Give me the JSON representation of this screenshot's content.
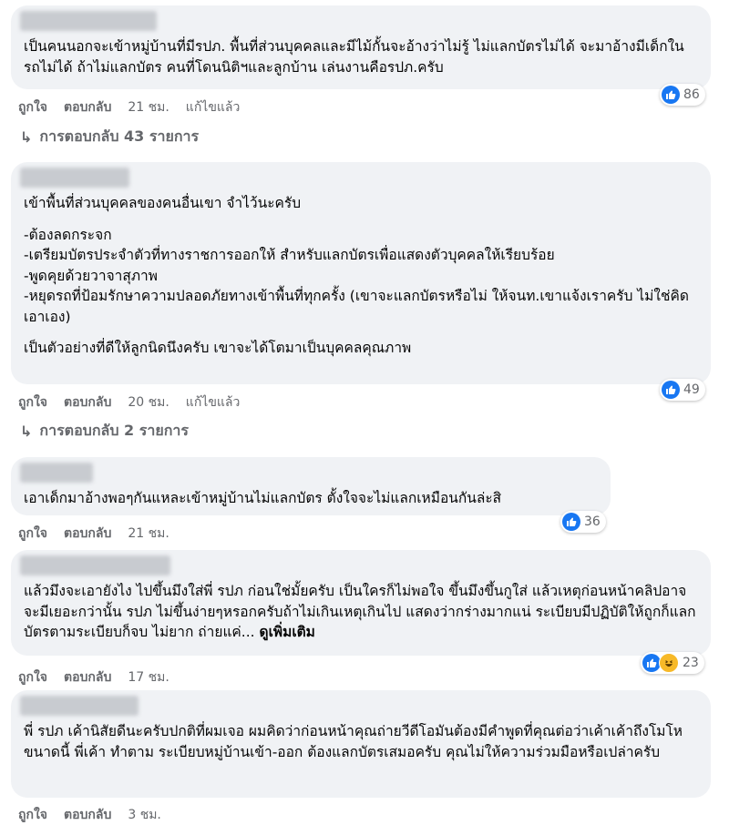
{
  "labels": {
    "like": "ถูกใจ",
    "reply": "ตอบกลับ",
    "see_more": "ดูเพิ่มเติม"
  },
  "comments": [
    {
      "paragraphs": [
        "เป็นคนนอกจะเข้าหมู่บ้านที่มีรปภ. พื้นที่ส่วนบุคคลและมีไม้กั้นจะอ้างว่าไม่รู้ ไม่แลกบัตรไม่ได้ จะมาอ้างมีเด็กในรถไม่ได้ ถ้าไม่แลกบัตร คนที่โดนนิติฯและลูกบ้าน เล่นงานคือรปภ.ครับ"
      ],
      "time": "21 ชม.",
      "edited": "แก้ไขแล้ว",
      "reactions": "86",
      "replies": "การตอบกลับ 43 รายการ"
    },
    {
      "paragraphs": [
        "เข้าพื้นที่ส่วนบุคคลของคนอื่นเขา จำไว้นะครับ",
        "-ต้องลดกระจก",
        "-เตรียมบัตรประจำตัวที่ทางราชการออกให้ สำหรับแลกบัตรเพื่อแสดงตัวบุคคลให้เรียบร้อย",
        "-พูดคุยด้วยวาจาสุภาพ",
        "-หยุดรถที่ป้อมรักษาความปลอดภัยทางเข้าพื้นที่ทุกครั้ง (เขาจะแลกบัตรหรือไม่ ให้จนท.เขาแจ้งเราครับ ไม่ใช่คิดเอาเอง)",
        "เป็นตัวอย่างที่ดีให้ลูกนิดนึงครับ เขาจะได้โตมาเป็นบุคคลคุณภาพ"
      ],
      "time": "20 ชม.",
      "edited": "แก้ไขแล้ว",
      "reactions": "49",
      "replies": "การตอบกลับ 2 รายการ"
    },
    {
      "paragraphs": [
        "เอาเด็กมาอ้างพอๆกันแหละเข้าหมู่บ้านไม่แลกบัตร ตั้งใจจะไม่แลกเหมือนกันล่ะสิ"
      ],
      "time": "21 ชม.",
      "reactions": "36"
    },
    {
      "paragraphs": [
        "แล้วมึงจะเอายังไง ไปขึ้นมึงใส่พี่ รปภ ก่อนใช่มั้ยครับ เป็นใครก็ไม่พอใจ ขึ้นมึงขึ้นกูใส่ แล้วเหตุก่อนหน้าคลิปอาจจะมีเยอะกว่านั้น รปภ ไม่ขึ้นง่ายๆหรอกครับถ้าไม่เกินเหตุเกินไป แสดงว่ากร่างมากแน่ ระเบียบมีปฏิบัติให้ถูกก็แลกบัตรตามระเบียบก็จบ ไม่ยาก ถ่ายแค่..."
      ],
      "time": "17 ชม.",
      "reactions": "23"
    },
    {
      "paragraphs": [
        "พี่ รปภ เค้านิสัยดีนะครับปกติที่ผมเจอ ผมคิดว่าก่อนหน้าคุณถ่ายวีดีโอมันต้องมีคำพูดที่คุณต่อว่าเค้าเค้าถึงโมโหขนาดนี้ พี่เค้า ทำตาม ระเบียบหมู่บ้านเข้า-ออก ต้องแลกบัตรเสมอครับ คุณไม่ให้ความร่วมมือหรือเปล่าครับ"
      ],
      "time": "3 ชม."
    }
  ]
}
